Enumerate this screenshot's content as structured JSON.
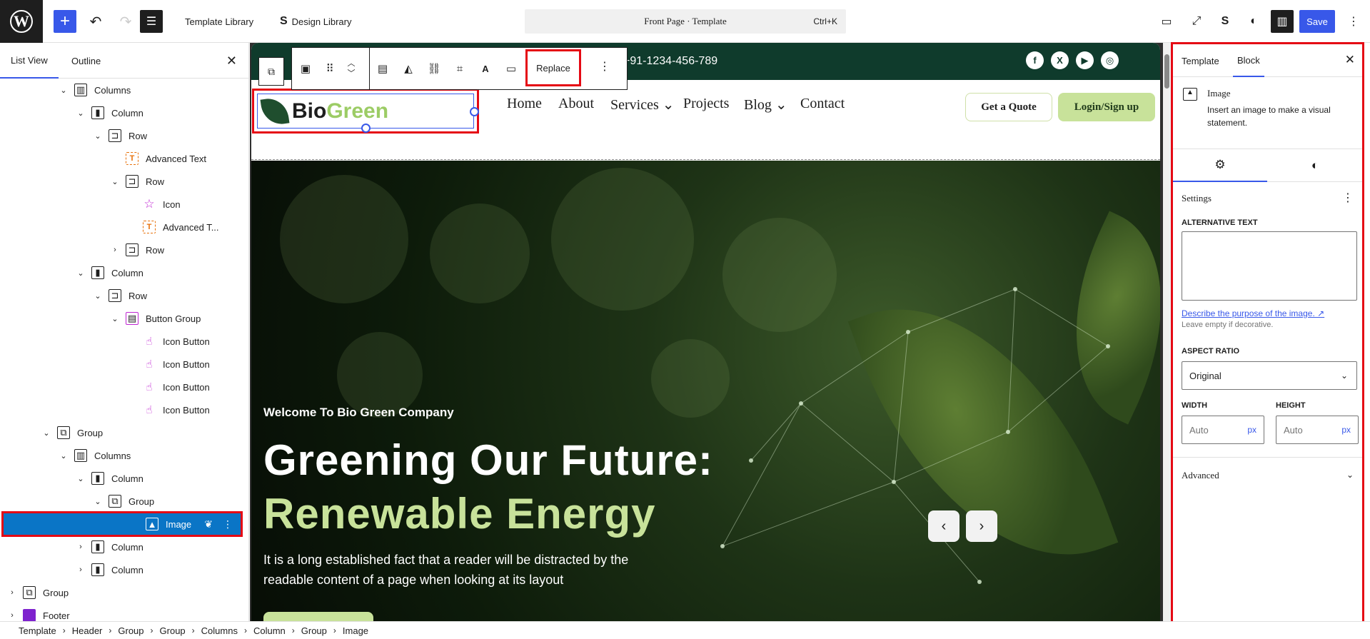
{
  "topbar": {
    "template_library": "Template Library",
    "design_library": "Design Library",
    "command_title": "Front Page · Template",
    "command_shortcut": "Ctrl+K",
    "save_label": "Save"
  },
  "left_panel": {
    "tabs": [
      "List View",
      "Outline"
    ],
    "tree": [
      {
        "label": "Columns",
        "depth": 3,
        "icon": "columns-icon",
        "chevron": "down"
      },
      {
        "label": "Column",
        "depth": 4,
        "icon": "column-icon",
        "chevron": "down"
      },
      {
        "label": "Row",
        "depth": 5,
        "icon": "row-icon",
        "chevron": "down"
      },
      {
        "label": "Advanced Text",
        "depth": 6,
        "icon": "advanced-text-icon",
        "chevron": ""
      },
      {
        "label": "Row",
        "depth": 6,
        "icon": "row-icon",
        "chevron": "down"
      },
      {
        "label": "Icon",
        "depth": 7,
        "icon": "star-icon",
        "chevron": ""
      },
      {
        "label": "Advanced T...",
        "depth": 7,
        "icon": "advanced-text-icon",
        "chevron": ""
      },
      {
        "label": "Row",
        "depth": 6,
        "icon": "row-icon",
        "chevron": "right"
      },
      {
        "label": "Column",
        "depth": 4,
        "icon": "column-icon",
        "chevron": "down"
      },
      {
        "label": "Row",
        "depth": 5,
        "icon": "row-icon",
        "chevron": "down"
      },
      {
        "label": "Button Group",
        "depth": 6,
        "icon": "button-group-icon",
        "chevron": "down"
      },
      {
        "label": "Icon Button",
        "depth": 7,
        "icon": "hand-pointer-icon",
        "chevron": ""
      },
      {
        "label": "Icon Button",
        "depth": 7,
        "icon": "hand-pointer-icon",
        "chevron": ""
      },
      {
        "label": "Icon Button",
        "depth": 7,
        "icon": "hand-pointer-icon",
        "chevron": ""
      },
      {
        "label": "Icon Button",
        "depth": 7,
        "icon": "hand-pointer-icon",
        "chevron": ""
      },
      {
        "label": "Group",
        "depth": 2,
        "icon": "group-icon",
        "chevron": "down"
      },
      {
        "label": "Columns",
        "depth": 3,
        "icon": "columns-icon",
        "chevron": "down"
      },
      {
        "label": "Column",
        "depth": 4,
        "icon": "column-icon",
        "chevron": "down"
      },
      {
        "label": "Group",
        "depth": 5,
        "icon": "group-icon",
        "chevron": "down"
      },
      {
        "label": "Image",
        "depth": 7,
        "icon": "image-icon",
        "chevron": "",
        "selected": true
      },
      {
        "label": "Column",
        "depth": 4,
        "icon": "column-icon",
        "chevron": "right"
      },
      {
        "label": "Column",
        "depth": 4,
        "icon": "column-icon",
        "chevron": "right"
      },
      {
        "label": "Group",
        "depth": 0,
        "icon": "group-icon",
        "chevron": "right"
      },
      {
        "label": "Footer",
        "depth": 0,
        "icon": "footer-icon",
        "chevron": "right"
      }
    ]
  },
  "canvas": {
    "toolbar": {
      "replace_label": "Replace"
    },
    "topstrip": {
      "phone": "+91-1234-456-789",
      "social": [
        "f",
        "X",
        "▶",
        "◎"
      ]
    },
    "logo": {
      "bio": "Bio",
      "green": "Green"
    },
    "nav": [
      "Home",
      "About",
      "Services ⌄",
      "Projects",
      "Blog ⌄",
      "Contact"
    ],
    "quote_btn": "Get a Quote",
    "login_btn": "Login/Sign up",
    "hero": {
      "welcome": "Welcome To Bio Green Company",
      "title_line1": "Greening Our Future:",
      "title_line2": "Renewable Energy",
      "paragraph": "It is a long established fact that a reader will be distracted by the readable content of a page when looking at its layout",
      "prev": "‹",
      "next": "›"
    }
  },
  "right_panel": {
    "tabs": [
      "Template",
      "Block"
    ],
    "block": {
      "title": "Image",
      "description": "Insert an image to make a visual statement."
    },
    "settings_label": "Settings",
    "alt_text_label": "ALTERNATIVE TEXT",
    "alt_text_value": "",
    "describe_link": "Describe the purpose of the image. ↗",
    "describe_hint": "Leave empty if decorative.",
    "aspect_label": "ASPECT RATIO",
    "aspect_value": "Original",
    "width_label": "WIDTH",
    "height_label": "HEIGHT",
    "width_placeholder": "Auto",
    "height_placeholder": "Auto",
    "unit": "px",
    "advanced_label": "Advanced"
  },
  "breadcrumb": [
    "Template",
    "Header",
    "Group",
    "Group",
    "Columns",
    "Column",
    "Group",
    "Image"
  ],
  "colors": {
    "accent": "#3858e9",
    "highlight": "#e50914",
    "brand_green": "#c8e29a",
    "dark_green": "#0f3b2c"
  }
}
